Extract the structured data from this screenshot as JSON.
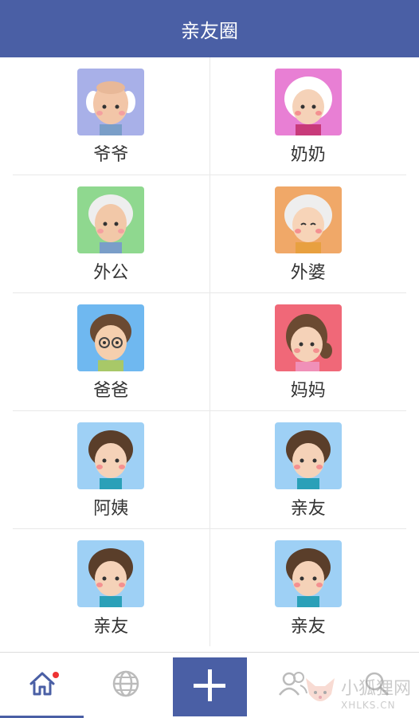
{
  "header": {
    "title": "亲友圈"
  },
  "contacts": [
    {
      "name": "爷爷",
      "bg": "#a8b0e8"
    },
    {
      "name": "奶奶",
      "bg": "#e87fd4"
    },
    {
      "name": "外公",
      "bg": "#8fd88f"
    },
    {
      "name": "外婆",
      "bg": "#f0a868"
    },
    {
      "name": "爸爸",
      "bg": "#6fb8f0"
    },
    {
      "name": "妈妈",
      "bg": "#f06878"
    },
    {
      "name": "阿姨",
      "bg": "#9ed0f5"
    },
    {
      "name": "亲友",
      "bg": "#9ed0f5"
    },
    {
      "name": "亲友",
      "bg": "#9ed0f5"
    },
    {
      "name": "亲友",
      "bg": "#9ed0f5"
    }
  ],
  "tabbar": {
    "items": [
      "home-icon",
      "globe-icon",
      "plus-icon",
      "people-icon",
      "search-icon"
    ],
    "active": "home-icon"
  },
  "watermark": {
    "cn": "小狐狸网",
    "en": "XHLKS.CN"
  },
  "colors": {
    "primary": "#4a5fa5",
    "badge": "#ee3333"
  }
}
